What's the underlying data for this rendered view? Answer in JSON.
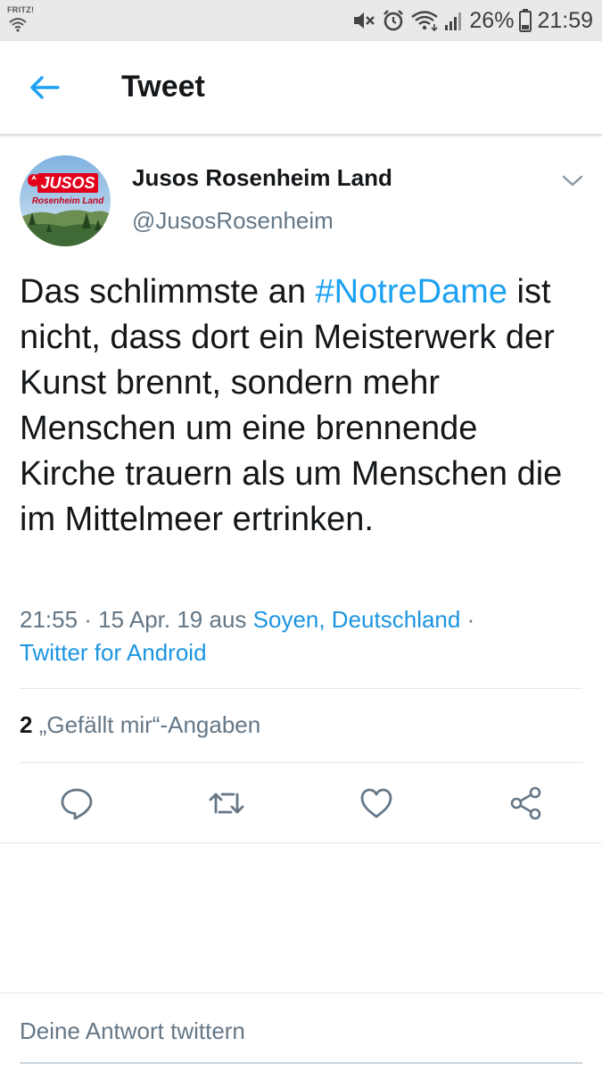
{
  "status_bar": {
    "carrier": "FRITZ!",
    "battery_percent": "26%",
    "time": "21:59",
    "icons": [
      "mute-icon",
      "alarm-icon",
      "wifi-icon",
      "signal-icon",
      "battery-icon"
    ]
  },
  "header": {
    "back_icon": "arrow-left-icon",
    "title": "Tweet"
  },
  "tweet": {
    "author": {
      "name": "Jusos Rosenheim Land",
      "handle": "@JusosRosenheim",
      "avatar_logo_text": "JUSOS",
      "avatar_subtext": "Rosenheim Land"
    },
    "text_before": "Das schlimmste an ",
    "hashtag": "#NotreDame",
    "text_after": " ist nicht, dass dort ein Meisterwerk der Kunst brennt, sondern mehr Menschen um eine brennende Kirche trauern als um Menschen die im Mittelmeer ertrinken.",
    "timestamp": "21:55 · 15 Apr. 19 aus ",
    "location": "Soyen, Deutschland",
    "separator": " ·",
    "source": "Twitter for Android",
    "likes_count": "2",
    "likes_label": " „Gefällt mir“-Angaben",
    "actions": [
      "reply-icon",
      "retweet-icon",
      "like-icon",
      "share-icon"
    ]
  },
  "reply": {
    "placeholder": "Deine Antwort twittern"
  },
  "colors": {
    "accent": "#1da1f2",
    "text_primary": "#14171a",
    "text_secondary": "#657786",
    "divider": "#e1e8ed",
    "jusos_red": "#e2001a"
  }
}
